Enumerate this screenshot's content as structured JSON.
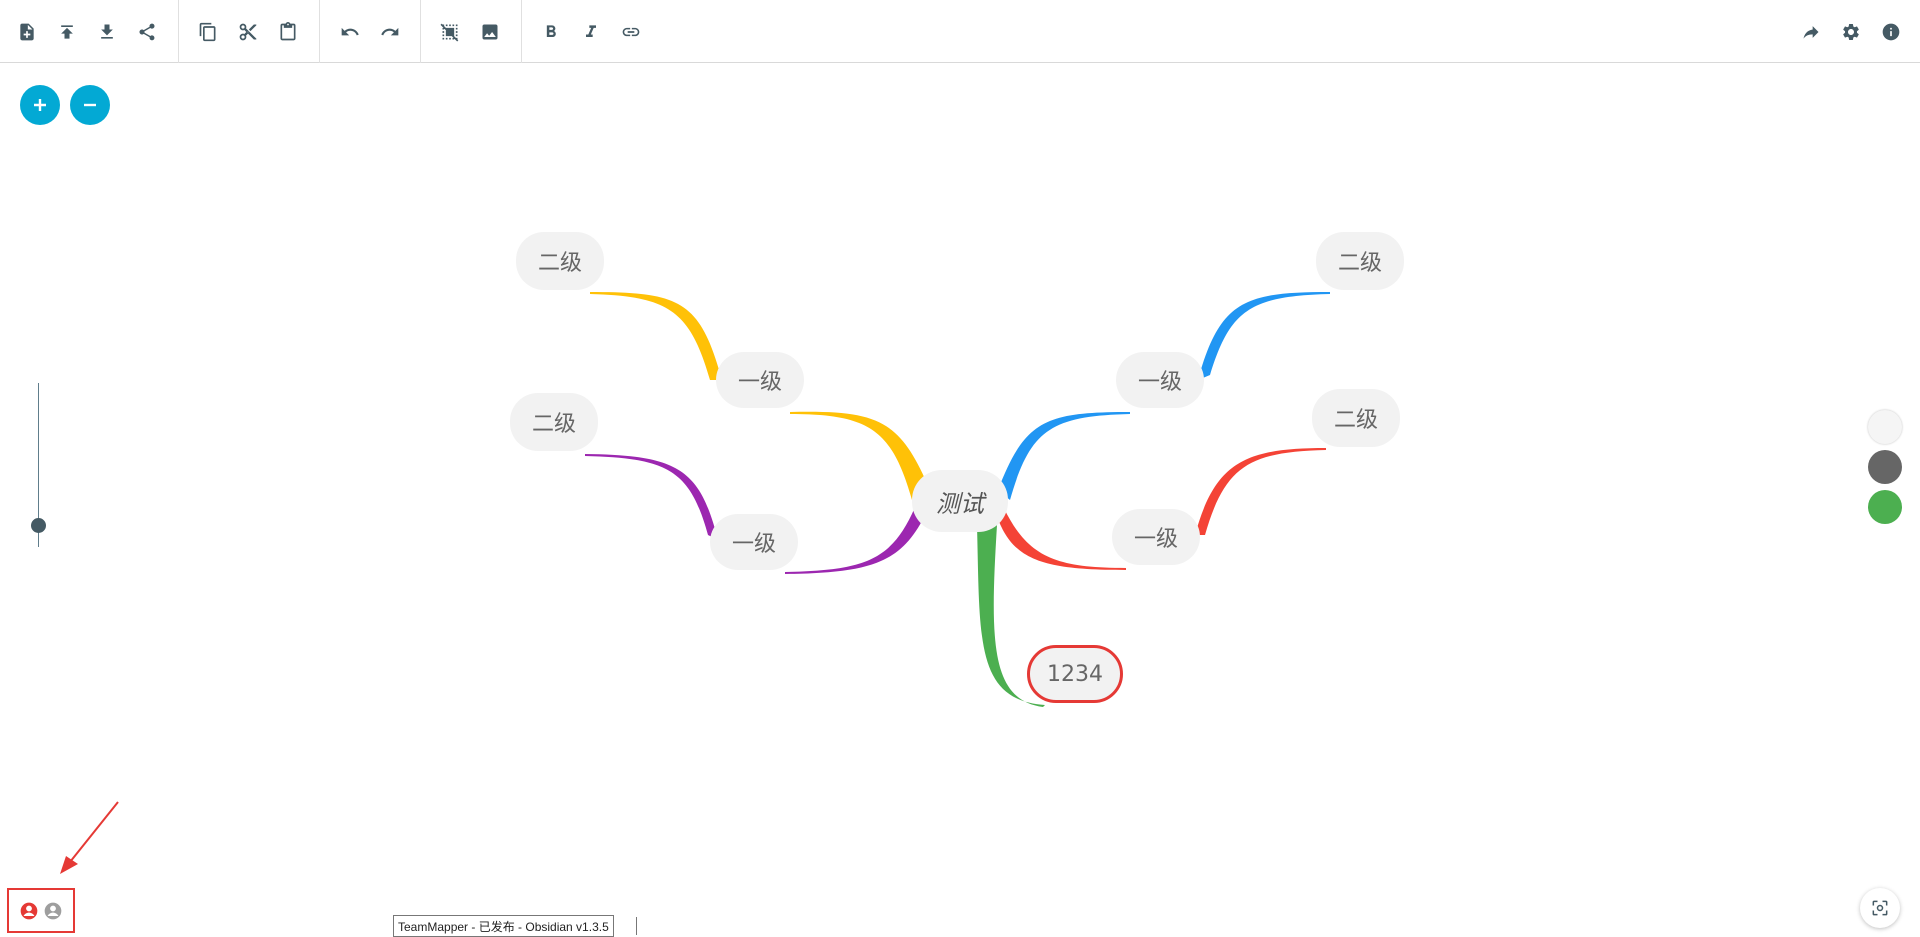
{
  "toolbar": {
    "left_groups": [
      [
        "new-map-icon",
        "upload-icon",
        "download-icon",
        "share-icon"
      ],
      [
        "copy-icon",
        "cut-icon",
        "paste-icon"
      ],
      [
        "undo-icon",
        "redo-icon"
      ],
      [
        "hide-branch-icon",
        "image-icon"
      ],
      [
        "bold-icon",
        "italic-icon",
        "link-icon"
      ]
    ],
    "right_buttons": [
      "forward-icon",
      "settings-icon",
      "info-icon"
    ]
  },
  "zoom": {
    "in_label": "+",
    "out_label": "−",
    "level": 0.15
  },
  "map": {
    "root": {
      "label": "测试",
      "style": "italic"
    },
    "branches": [
      {
        "label": "一级",
        "color": "#ffc107",
        "side": "left",
        "children": [
          {
            "label": "二级"
          }
        ]
      },
      {
        "label": "一级",
        "color": "#9c27b0",
        "side": "left",
        "children": [
          {
            "label": "二级"
          }
        ]
      },
      {
        "label": "一级",
        "color": "#2196f3",
        "side": "right",
        "children": [
          {
            "label": "二级"
          }
        ]
      },
      {
        "label": "一级",
        "color": "#f44336",
        "side": "right",
        "children": [
          {
            "label": "二级"
          }
        ]
      },
      {
        "label": "1234",
        "color": "#4caf50",
        "side": "bottom",
        "selected": true,
        "children": []
      }
    ]
  },
  "color_swatches": [
    "#f5f5f5",
    "#666666",
    "#4caf50"
  ],
  "users": [
    {
      "icon": "user-active-icon",
      "color": "#e53935"
    },
    {
      "icon": "user-icon",
      "color": "#9e9e9e"
    }
  ],
  "status_tooltip": "TeamMapper - 已发布 - Obsidian v1.3.5",
  "accent_color": "#03a9d4"
}
